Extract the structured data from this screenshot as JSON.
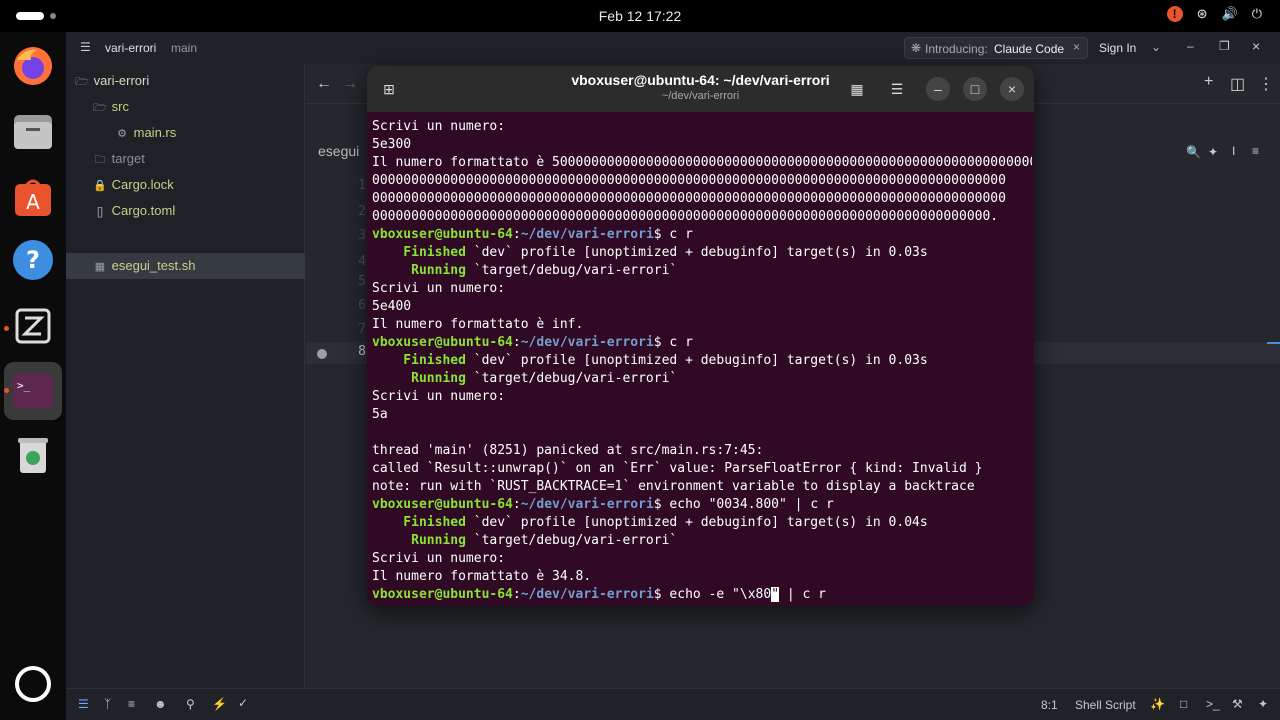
{
  "topbar": {
    "clock": "Feb 12  17:22",
    "alert_glyph": "!"
  },
  "editor": {
    "titlebar": {
      "project": "vari-errori",
      "branch": "main",
      "banner_prefix": "Introducing:",
      "banner_highlight": "Claude Code",
      "sign_in": "Sign In"
    },
    "tree": [
      {
        "label": "vari-errori",
        "icon": "folder-open-icon",
        "indent": 0,
        "expanded": true
      },
      {
        "label": "src",
        "icon": "folder-open-icon",
        "indent": 1
      },
      {
        "label": "main.rs",
        "icon": "rust-file-icon",
        "indent": 2
      },
      {
        "label": "target",
        "icon": "folder-icon",
        "indent": 1
      },
      {
        "label": "Cargo.lock",
        "icon": "lock-icon",
        "indent": 1
      },
      {
        "label": "Cargo.toml",
        "icon": "toml-file-icon",
        "indent": 1
      },
      {
        "label": "esegui_test.sh",
        "icon": "shell-file-icon",
        "indent": 1,
        "selected": true
      }
    ],
    "tab_partial": "esegui",
    "gutter": [
      "1",
      "2",
      "3",
      "4",
      "5",
      "6",
      "7",
      "8"
    ],
    "status": {
      "position": "8:1",
      "language": "Shell Script"
    }
  },
  "terminal": {
    "title": "vboxuser@ubuntu-64: ~/dev/vari-errori",
    "subtitle": "~/dev/vari-errori",
    "prompt_user": "vboxuser@ubuntu-64",
    "prompt_sep": ":",
    "prompt_path": "~/dev/vari-errori",
    "prompt_dollar": "$",
    "lines": [
      {
        "kind": "text",
        "text": "Scrivi un numero:"
      },
      {
        "kind": "text",
        "text": "5e300"
      },
      {
        "kind": "text",
        "text": "Il numero formattato è 5000000000000000000000000000000000000000000000000000000000000000"
      },
      {
        "kind": "text",
        "text": "000000000000000000000000000000000000000000000000000000000000000000000000000000000"
      },
      {
        "kind": "text",
        "text": "000000000000000000000000000000000000000000000000000000000000000000000000000000000"
      },
      {
        "kind": "text",
        "text": "0000000000000000000000000000000000000000000000000000000000000000000000000000000."
      },
      {
        "kind": "prompt",
        "cmd": " c r"
      },
      {
        "kind": "cargo",
        "tag": "    Finished",
        "rest": " `dev` profile [unoptimized + debuginfo] target(s) in 0.03s"
      },
      {
        "kind": "cargo",
        "tag": "     Running",
        "rest": " `target/debug/vari-errori`"
      },
      {
        "kind": "text",
        "text": "Scrivi un numero:"
      },
      {
        "kind": "text",
        "text": "5e400"
      },
      {
        "kind": "text",
        "text": "Il numero formattato è inf."
      },
      {
        "kind": "prompt",
        "cmd": " c r"
      },
      {
        "kind": "cargo",
        "tag": "    Finished",
        "rest": " `dev` profile [unoptimized + debuginfo] target(s) in 0.03s"
      },
      {
        "kind": "cargo",
        "tag": "     Running",
        "rest": " `target/debug/vari-errori`"
      },
      {
        "kind": "text",
        "text": "Scrivi un numero:"
      },
      {
        "kind": "text",
        "text": "5a"
      },
      {
        "kind": "text",
        "text": ""
      },
      {
        "kind": "text",
        "text": "thread 'main' (8251) panicked at src/main.rs:7:45:"
      },
      {
        "kind": "text",
        "text": "called `Result::unwrap()` on an `Err` value: ParseFloatError { kind: Invalid }"
      },
      {
        "kind": "text",
        "text": "note: run with `RUST_BACKTRACE=1` environment variable to display a backtrace"
      },
      {
        "kind": "prompt",
        "cmd": " echo \"0034.800\" | c r"
      },
      {
        "kind": "cargo",
        "tag": "    Finished",
        "rest": " `dev` profile [unoptimized + debuginfo] target(s) in 0.04s"
      },
      {
        "kind": "cargo",
        "tag": "     Running",
        "rest": " `target/debug/vari-errori`"
      },
      {
        "kind": "text",
        "text": "Scrivi un numero:"
      },
      {
        "kind": "text",
        "text": "Il numero formattato è 34.8."
      },
      {
        "kind": "prompt_cursor",
        "cmd_before": " echo -e \"\\x80",
        "cursor_char": "\"",
        "cmd_after": " | c r"
      }
    ]
  },
  "colors": {
    "terminal_bg": "#300a24",
    "prompt_user": "#8ae234",
    "prompt_path": "#729fcf",
    "accent_orange": "#e9542f"
  }
}
